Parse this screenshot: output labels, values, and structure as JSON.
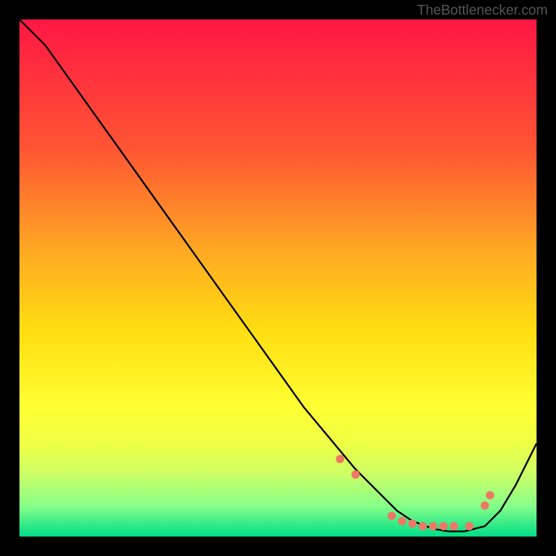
{
  "watermark": "TheBottlenecker.com",
  "chart_data": {
    "type": "line",
    "title": "",
    "xlabel": "",
    "ylabel": "",
    "xlim": [
      0,
      100
    ],
    "ylim": [
      0,
      100
    ],
    "gradient_stops": [
      {
        "offset": 0,
        "color": "#ff1744"
      },
      {
        "offset": 25,
        "color": "#ff5533"
      },
      {
        "offset": 45,
        "color": "#ffaa22"
      },
      {
        "offset": 60,
        "color": "#ffdd11"
      },
      {
        "offset": 75,
        "color": "#ffff33"
      },
      {
        "offset": 82,
        "color": "#eeff44"
      },
      {
        "offset": 88,
        "color": "#ccff66"
      },
      {
        "offset": 94,
        "color": "#88ff88"
      },
      {
        "offset": 100,
        "color": "#00dd88"
      }
    ],
    "series": [
      {
        "name": "curve",
        "x": [
          0,
          5,
          10,
          15,
          20,
          25,
          30,
          35,
          40,
          45,
          50,
          55,
          60,
          65,
          70,
          73,
          76,
          80,
          83,
          86,
          90,
          93,
          96,
          100
        ],
        "y": [
          100,
          95,
          88,
          81,
          74,
          67,
          60,
          53,
          46,
          39,
          32,
          25,
          19,
          13,
          8,
          5,
          3,
          1.5,
          1,
          1,
          2,
          5,
          10,
          18
        ]
      }
    ],
    "markers": {
      "name": "dots",
      "color": "#ee7766",
      "x": [
        62,
        65,
        72,
        74,
        76,
        78,
        80,
        82,
        84,
        87,
        90,
        91
      ],
      "y": [
        15,
        12,
        4,
        3,
        2.5,
        2,
        2,
        2,
        2,
        2,
        6,
        8
      ]
    }
  }
}
